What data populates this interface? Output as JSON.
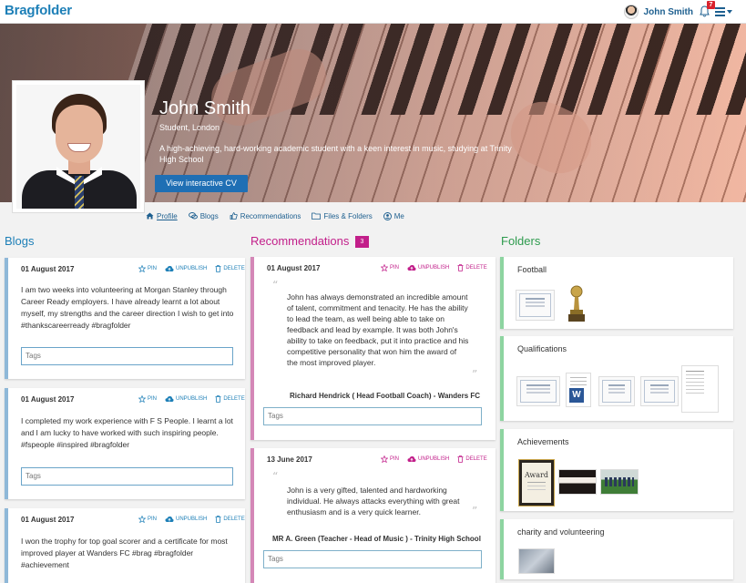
{
  "app": {
    "logo": "Bragfolder"
  },
  "topnav": {
    "user_name": "John Smith",
    "notification_count": "7"
  },
  "profile": {
    "name": "John Smith",
    "subtitle": "Student, London",
    "description": "A high-achieving, hard-working academic student with a keen interest in music, studying at Trinity High School",
    "cv_button": "View interactive CV"
  },
  "tabs": [
    {
      "label": "Profile",
      "icon": "home-icon"
    },
    {
      "label": "Blogs",
      "icon": "chat-icon"
    },
    {
      "label": "Recommendations",
      "icon": "thumbs-up-icon"
    },
    {
      "label": "Files & Folders",
      "icon": "folder-icon"
    },
    {
      "label": "Me",
      "icon": "user-circle-icon"
    }
  ],
  "sections": {
    "blogs": "Blogs",
    "recommendations": "Recommendations",
    "recommendations_count": "3",
    "folders": "Folders"
  },
  "actions": {
    "pin": "PIN",
    "unpublish": "UNPUBLISH",
    "delete": "DELETE"
  },
  "blogs": [
    {
      "date": "01 August 2017",
      "text": "I am two weeks into volunteering at Morgan Stanley through Career Ready employers. I have already learnt a lot about myself, my strengths and the career direction I wish to get into #thankscareerready #bragfolder",
      "tags_placeholder": "Tags"
    },
    {
      "date": "01 August 2017",
      "text": "I completed my work experience with F S People. I learnt a lot and I am lucky to have worked with such inspiring people. #fspeople #inspired #bragfolder",
      "tags_placeholder": "Tags"
    },
    {
      "date": "01 August 2017",
      "text": "I won the trophy for top goal scorer and a certificate for most improved player at Wanders FC #brag #bragfolder #achievement"
    }
  ],
  "recommendations": [
    {
      "date": "01 August 2017",
      "text": "John has always demonstrated an incredible amount of talent, commitment and tenacity. He has the ability to lead the team, as well being able to take on feedback and lead by example. It was both John's ability to take on feedback, put it into practice and his competitive personality that won him the award of the most improved player.",
      "author": "Richard Hendrick ( Head Football Coach) - Wanders FC",
      "tags_placeholder": "Tags"
    },
    {
      "date": "13 June 2017",
      "text": "John is a very gifted, talented and hardworking individual. He always attacks everything with great enthusiasm and is a very quick learner.",
      "author": "MR A. Green (Teacher - Head of Music ) - Trinity High School",
      "tags_placeholder": "Tags"
    }
  ],
  "folders": [
    {
      "title": "Football"
    },
    {
      "title": "Qualifications"
    },
    {
      "title": "Achievements",
      "award_text": "Award"
    },
    {
      "title": "charity and volunteering"
    }
  ],
  "colors": {
    "brand": "#1d7fb7",
    "recommendations": "#c21f8a",
    "folders": "#2e9b4e",
    "cv_button": "#1f6fb4"
  }
}
